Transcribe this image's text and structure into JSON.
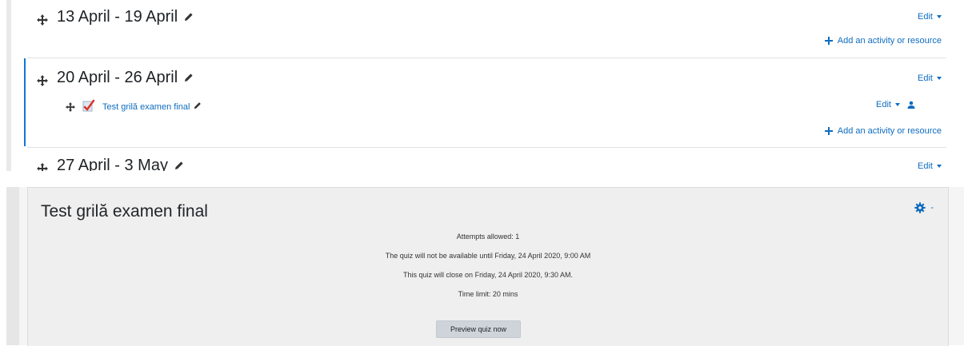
{
  "sections": [
    {
      "title": "13 April - 19 April",
      "edit_label": "Edit",
      "add_label": "Add an activity or resource"
    },
    {
      "title": "20 April - 26 April",
      "edit_label": "Edit",
      "add_label": "Add an activity or resource",
      "activity": {
        "name": "Test grilă examen final",
        "edit_label": "Edit"
      }
    },
    {
      "title": "27 April - 3 May",
      "edit_label": "Edit"
    }
  ],
  "quiz": {
    "title": "Test grilă examen final",
    "attempts": "Attempts allowed: 1",
    "available": "The quiz will not be available until Friday, 24 April 2020, 9:00 AM",
    "closes": "This quiz will close on Friday, 24 April 2020, 9:30 AM.",
    "time_limit": "Time limit: 20 mins",
    "preview_button": "Preview quiz now"
  },
  "colors": {
    "link": "#0f6cbf",
    "accent_bar": "#1177d1"
  },
  "icons": [
    "move-icon",
    "pencil-icon",
    "caret-down-icon",
    "plus-icon",
    "user-icon",
    "quiz-icon",
    "gear-icon"
  ]
}
